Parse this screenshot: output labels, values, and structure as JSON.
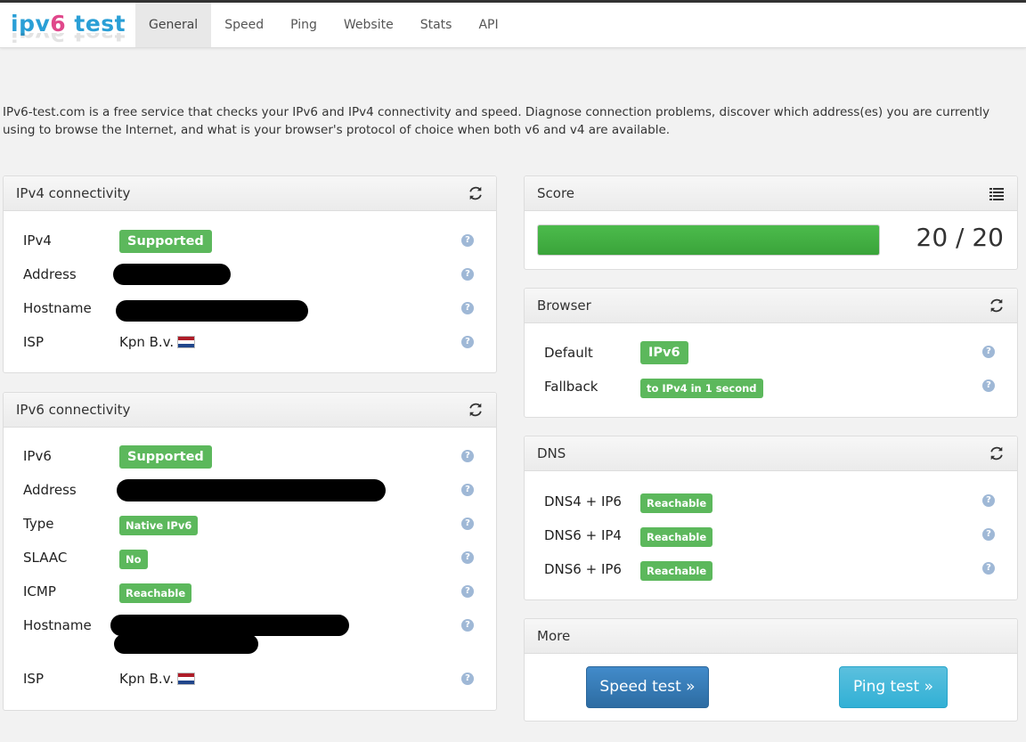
{
  "brand": {
    "part1": "ipv",
    "part2": "6",
    "part3": " test"
  },
  "nav": [
    "General",
    "Speed",
    "Ping",
    "Website",
    "Stats",
    "API"
  ],
  "intro": "IPv6-test.com is a free service that checks your IPv6 and IPv4 connectivity and speed. Diagnose connection problems, discover which address(es) you are currently using to browse the Internet, and what is your browser's protocol of choice when both v6 and v4 are available.",
  "ipv4": {
    "title": "IPv4 connectivity",
    "rows": {
      "ipv4": {
        "label": "IPv4",
        "badge": "Supported"
      },
      "address": {
        "label": "Address"
      },
      "hostname": {
        "label": "Hostname"
      },
      "isp": {
        "label": "ISP",
        "value": "Kpn B.v."
      }
    }
  },
  "ipv6": {
    "title": "IPv6 connectivity",
    "rows": {
      "ipv6": {
        "label": "IPv6",
        "badge": "Supported"
      },
      "address": {
        "label": "Address"
      },
      "type": {
        "label": "Type",
        "badge": "Native IPv6"
      },
      "slaac": {
        "label": "SLAAC",
        "badge": "No"
      },
      "icmp": {
        "label": "ICMP",
        "badge": "Reachable"
      },
      "hostname": {
        "label": "Hostname"
      },
      "isp": {
        "label": "ISP",
        "value": "Kpn B.v."
      }
    }
  },
  "score": {
    "title": "Score",
    "text": "20 / 20",
    "value": 20,
    "max": 20
  },
  "browser": {
    "title": "Browser",
    "default": {
      "label": "Default",
      "badge": "IPv6"
    },
    "fallback": {
      "label": "Fallback",
      "badge": "to IPv4 in 1 second"
    }
  },
  "dns": {
    "title": "DNS",
    "rows": [
      {
        "label": "DNS4 + IP6",
        "badge": "Reachable"
      },
      {
        "label": "DNS6 + IP4",
        "badge": "Reachable"
      },
      {
        "label": "DNS6 + IP6",
        "badge": "Reachable"
      }
    ]
  },
  "more": {
    "title": "More",
    "speed_btn": "Speed test »",
    "ping_btn": "Ping test »"
  },
  "colors": {
    "success": "#5cb85c",
    "primary": "#428bca",
    "info": "#5bc0de",
    "brand_blue": "#2a9fd6",
    "brand_pink": "#e0488b"
  },
  "icons": {
    "refresh": "refresh-icon",
    "list": "list-icon",
    "help": "help-icon",
    "flag": "netherlands-flag-icon"
  }
}
